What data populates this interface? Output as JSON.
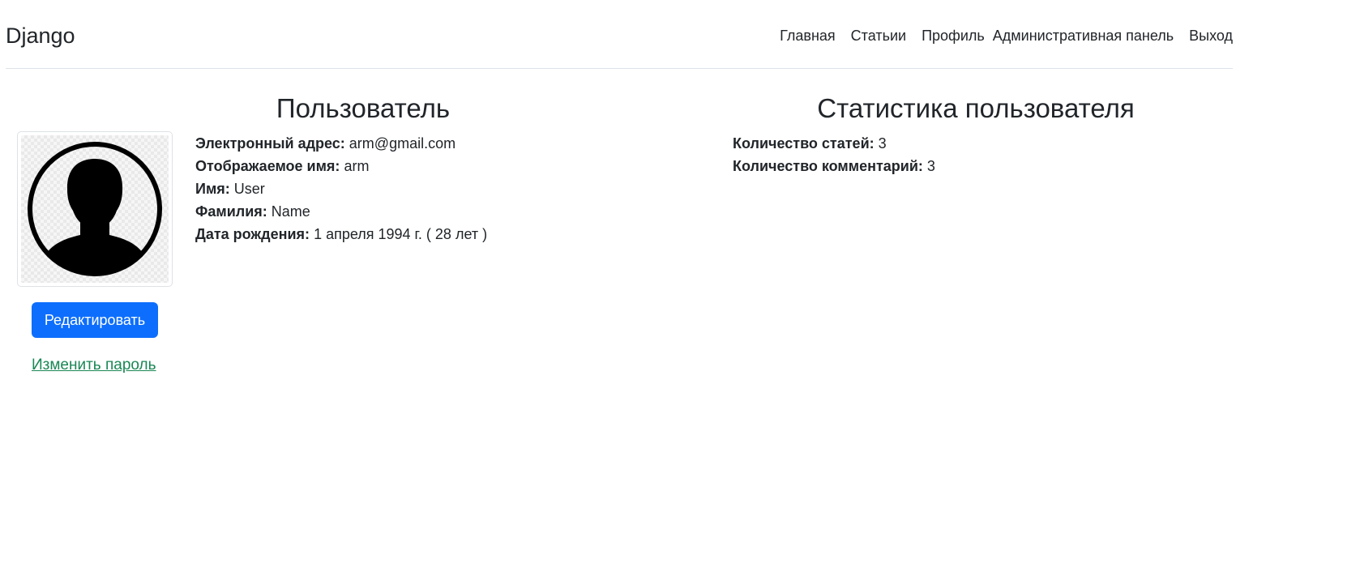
{
  "navbar": {
    "brand": "Django",
    "links": [
      "Главная",
      "Статьии",
      "Профиль",
      "Административная панель",
      "Выход"
    ]
  },
  "profile": {
    "title": "Пользователь",
    "fields": [
      {
        "label": "Электронный адрес:",
        "value": "arm@gmail.com"
      },
      {
        "label": "Отображаемое имя:",
        "value": "arm"
      },
      {
        "label": "Имя:",
        "value": "User"
      },
      {
        "label": "Фамилия:",
        "value": "Name"
      },
      {
        "label": "Дата рождения:",
        "value": "1 апреля 1994 г. ( 28 лет )"
      }
    ],
    "edit_button": "Редактировать",
    "change_password_link": "Изменить пароль",
    "avatar_icon": "user-silhouette-icon"
  },
  "stats": {
    "title": "Статистика пользователя",
    "fields": [
      {
        "label": "Количество статей:",
        "value": "3"
      },
      {
        "label": "Количество комментарий:",
        "value": "3"
      }
    ]
  },
  "colors": {
    "primary": "#0d6efd",
    "link_success": "#198754",
    "text": "#212529",
    "border": "#dee2e6"
  }
}
